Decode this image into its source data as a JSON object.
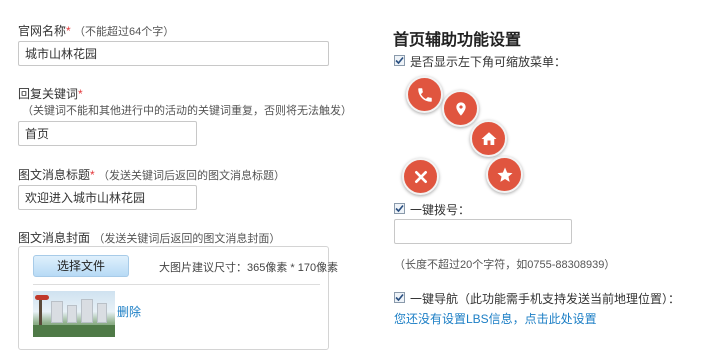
{
  "form": {
    "site_name": {
      "label": "官网名称",
      "required": "*",
      "hint": "（不能超过64个字）",
      "value": "城市山林花园"
    },
    "reply_keyword": {
      "label": "回复关键词",
      "required": "*",
      "hint": "（关键词不能和其他进行中的活动的关键词重复，否则将无法触发）",
      "value": "首页"
    },
    "news_title": {
      "label": "图文消息标题",
      "required": "*",
      "hint": "（发送关键词后返回的图文消息标题）",
      "value": "欢迎进入城市山林花园"
    },
    "news_cover": {
      "label": "图文消息封面",
      "hint": "（发送关键词后返回的图文消息封面）",
      "upload_button": "选择文件",
      "size_hint": "大图片建议尺寸：365像素 * 170像素",
      "delete_link": "删除"
    }
  },
  "assist": {
    "title": "首页辅助功能设置",
    "show_menu_label": "是否显示左下角可缩放菜单：",
    "show_menu_checked": true,
    "menu_icons": [
      "phone-icon",
      "location-pin-icon",
      "home-icon",
      "close-icon",
      "star-icon"
    ],
    "one_key_dial_label": "一键拨号：",
    "one_key_dial_checked": true,
    "phone_value": "",
    "phone_hint": "（长度不超过20个字符，如0755-88308939）",
    "one_key_nav_label": "一键导航（此功能需手机支持发送当前地理位置）：",
    "one_key_nav_checked": true,
    "lbs_link": "您还没有设置LBS信息，点击此处设置"
  },
  "colors": {
    "accent": "#e0553f",
    "link": "#1b7ec5",
    "required": "#e4393c"
  }
}
